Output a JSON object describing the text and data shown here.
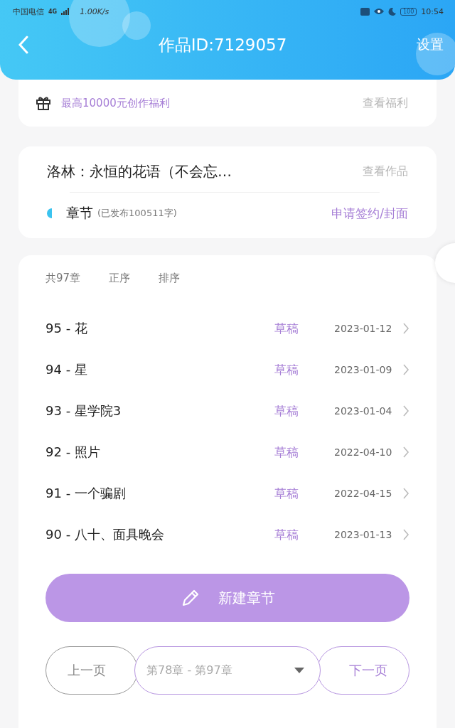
{
  "status_bar": {
    "carrier": "中国电信",
    "network": "4G",
    "speed": "1.00K/s",
    "battery": "100",
    "time": "10:54"
  },
  "header": {
    "title": "作品ID:7129057",
    "action": "设置"
  },
  "promo": {
    "text": "最高10000元创作福利",
    "link": "查看福利"
  },
  "work": {
    "title": "洛林：永恒的花语（不会忘…",
    "link": "查看作品",
    "section": "章节",
    "published": "(已发布100511字)",
    "action": "申请签约/封面"
  },
  "chapters": {
    "count": "共97章",
    "sorts": [
      {
        "label": "正序",
        "selected": false
      },
      {
        "label": "排序",
        "selected": false
      }
    ],
    "rows": [
      {
        "title": "95 - 花",
        "status": "草稿",
        "date": "2023-01-12"
      },
      {
        "title": "94 - 星",
        "status": "草稿",
        "date": "2023-01-09"
      },
      {
        "title": "93 - 星学院3",
        "status": "草稿",
        "date": "2023-01-04"
      },
      {
        "title": "92 - 照片",
        "status": "草稿",
        "date": "2022-04-10"
      },
      {
        "title": "91 - 一个骗剧",
        "status": "草稿",
        "date": "2022-04-15"
      },
      {
        "title": "90 - 八十、面具晚会",
        "status": "草稿",
        "date": "2023-01-13"
      }
    ],
    "new_button": "新建章节"
  },
  "pager": {
    "prev": {
      "label": "上一页",
      "disabled": true
    },
    "range": "第78章 - 第97章",
    "next": {
      "label": "下一页",
      "disabled": false
    }
  }
}
